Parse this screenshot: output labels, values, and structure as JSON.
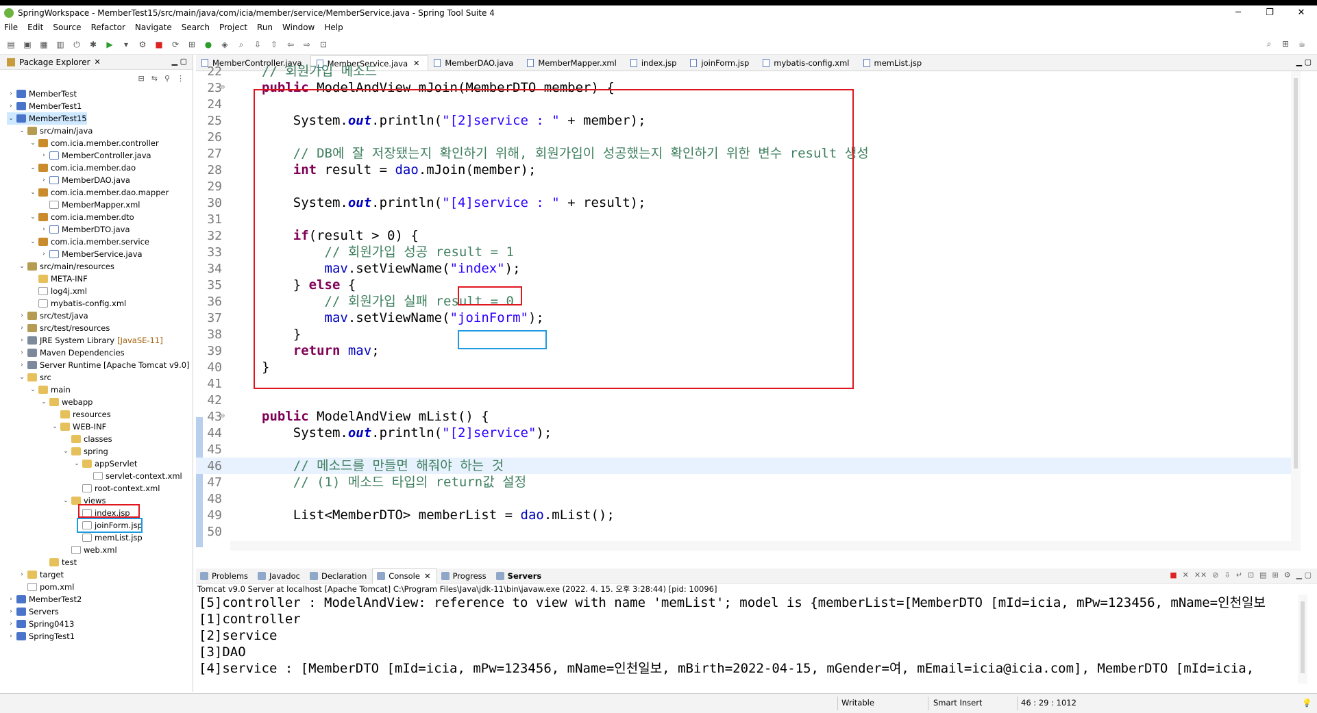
{
  "window": {
    "title": "SpringWorkspace - MemberTest15/src/main/java/com/icia/member/service/MemberService.java - Spring Tool Suite 4",
    "minimize": "─",
    "maximize": "❐",
    "close": "✕"
  },
  "menu": [
    "File",
    "Edit",
    "Source",
    "Refactor",
    "Navigate",
    "Search",
    "Project",
    "Run",
    "Window",
    "Help"
  ],
  "explorer": {
    "title": "Package Explorer",
    "items": [
      {
        "label": "MemberTest",
        "twisty": "›",
        "icon": "project"
      },
      {
        "label": "MemberTest1",
        "twisty": "›",
        "icon": "project"
      },
      {
        "label": "MemberTest15",
        "twisty": "⌄",
        "icon": "project"
      },
      {
        "label": "src/main/java",
        "twisty": "⌄",
        "icon": "srcf"
      },
      {
        "label": "com.icia.member.controller",
        "twisty": "⌄",
        "icon": "pkg"
      },
      {
        "label": "MemberController.java",
        "twisty": "›",
        "icon": "java"
      },
      {
        "label": "com.icia.member.dao",
        "twisty": "⌄",
        "icon": "pkg"
      },
      {
        "label": "MemberDAO.java",
        "twisty": "›",
        "icon": "java"
      },
      {
        "label": "com.icia.member.dao.mapper",
        "twisty": "⌄",
        "icon": "pkg"
      },
      {
        "label": "MemberMapper.xml",
        "twisty": "",
        "icon": "xml"
      },
      {
        "label": "com.icia.member.dto",
        "twisty": "⌄",
        "icon": "pkg"
      },
      {
        "label": "MemberDTO.java",
        "twisty": "›",
        "icon": "java"
      },
      {
        "label": "com.icia.member.service",
        "twisty": "⌄",
        "icon": "pkg"
      },
      {
        "label": "MemberService.java",
        "twisty": "›",
        "icon": "java"
      },
      {
        "label": "src/main/resources",
        "twisty": "⌄",
        "icon": "srcf"
      },
      {
        "label": "META-INF",
        "twisty": "",
        "icon": "folder"
      },
      {
        "label": "log4j.xml",
        "twisty": "",
        "icon": "xml"
      },
      {
        "label": "mybatis-config.xml",
        "twisty": "",
        "icon": "xml"
      },
      {
        "label": "src/test/java",
        "twisty": "›",
        "icon": "srcf"
      },
      {
        "label": "src/test/resources",
        "twisty": "›",
        "icon": "srcf"
      },
      {
        "label": "JRE System Library",
        "twisty": "›",
        "icon": "lib",
        "suffix": "[JavaSE-11]"
      },
      {
        "label": "Maven Dependencies",
        "twisty": "›",
        "icon": "lib"
      },
      {
        "label": "Server Runtime [Apache Tomcat v9.0]",
        "twisty": "›",
        "icon": "lib"
      },
      {
        "label": "src",
        "twisty": "⌄",
        "icon": "folder"
      },
      {
        "label": "main",
        "twisty": "⌄",
        "icon": "folder"
      },
      {
        "label": "webapp",
        "twisty": "⌄",
        "icon": "folder"
      },
      {
        "label": "resources",
        "twisty": "",
        "icon": "folder"
      },
      {
        "label": "WEB-INF",
        "twisty": "⌄",
        "icon": "folder"
      },
      {
        "label": "classes",
        "twisty": "",
        "icon": "folder"
      },
      {
        "label": "spring",
        "twisty": "⌄",
        "icon": "folder"
      },
      {
        "label": "appServlet",
        "twisty": "⌄",
        "icon": "folder"
      },
      {
        "label": "servlet-context.xml",
        "twisty": "",
        "icon": "xml"
      },
      {
        "label": "root-context.xml",
        "twisty": "",
        "icon": "xml"
      },
      {
        "label": "views",
        "twisty": "⌄",
        "icon": "folder"
      },
      {
        "label": "index.jsp",
        "twisty": "",
        "icon": "xml"
      },
      {
        "label": "joinForm.jsp",
        "twisty": "",
        "icon": "xml"
      },
      {
        "label": "memList.jsp",
        "twisty": "",
        "icon": "xml"
      },
      {
        "label": "web.xml",
        "twisty": "",
        "icon": "xml"
      },
      {
        "label": "test",
        "twisty": "",
        "icon": "folder"
      },
      {
        "label": "target",
        "twisty": "›",
        "icon": "folder"
      },
      {
        "label": "pom.xml",
        "twisty": "",
        "icon": "xml"
      },
      {
        "label": "MemberTest2",
        "twisty": "›",
        "icon": "project"
      },
      {
        "label": "Servers",
        "twisty": "›",
        "icon": "project"
      },
      {
        "label": "Spring0413",
        "twisty": "›",
        "icon": "project"
      },
      {
        "label": "SpringTest1",
        "twisty": "›",
        "icon": "project"
      }
    ]
  },
  "editor_tabs": [
    {
      "label": "MemberController.java",
      "active": false
    },
    {
      "label": "MemberService.java",
      "active": true
    },
    {
      "label": "MemberDAO.java",
      "active": false
    },
    {
      "label": "MemberMapper.xml",
      "active": false
    },
    {
      "label": "index.jsp",
      "active": false
    },
    {
      "label": "joinForm.jsp",
      "active": false
    },
    {
      "label": "mybatis-config.xml",
      "active": false
    },
    {
      "label": "memList.jsp",
      "active": false
    }
  ],
  "code_lines": [
    {
      "n": "22",
      "html": "<span class=\"cm\">// 회원가입 메소드</span>"
    },
    {
      "n": "23",
      "html": "<span class=\"kw\">public</span> ModelAndView mJoin(MemberDTO member) {"
    },
    {
      "n": "24",
      "html": ""
    },
    {
      "n": "25",
      "html": "    System.<span class=\"sf\">out</span>.println(<span class=\"st\">\"[2]service : \"</span> + member);"
    },
    {
      "n": "26",
      "html": ""
    },
    {
      "n": "27",
      "html": "    <span class=\"cm\">// DB에 잘 저장됐는지 확인하기 위해, 회원가입이 성공했는지 확인하기 위한 변수 result 생성</span>"
    },
    {
      "n": "28",
      "html": "    <span class=\"kw\">int</span> result = <span class=\"fd\">dao</span>.mJoin(member);"
    },
    {
      "n": "29",
      "html": ""
    },
    {
      "n": "30",
      "html": "    System.<span class=\"sf\">out</span>.println(<span class=\"st\">\"[4]service : \"</span> + result);"
    },
    {
      "n": "31",
      "html": ""
    },
    {
      "n": "32",
      "html": "    <span class=\"kw\">if</span>(result > 0) {"
    },
    {
      "n": "33",
      "html": "        <span class=\"cm\">// 회원가입 성공 result = 1</span>"
    },
    {
      "n": "34",
      "html": "        <span class=\"fd\">mav</span>.setViewName(<span class=\"st\">\"index\"</span>);"
    },
    {
      "n": "35",
      "html": "    } <span class=\"kw\">else</span> {"
    },
    {
      "n": "36",
      "html": "        <span class=\"cm\">// 회원가입 실패 result = 0</span>"
    },
    {
      "n": "37",
      "html": "        <span class=\"fd\">mav</span>.setViewName(<span class=\"st\">\"joinForm\"</span>);"
    },
    {
      "n": "38",
      "html": "    }"
    },
    {
      "n": "39",
      "html": "    <span class=\"kw\">return</span> <span class=\"fd\">mav</span>;"
    },
    {
      "n": "40",
      "html": "}"
    },
    {
      "n": "41",
      "html": ""
    },
    {
      "n": "42",
      "html": ""
    },
    {
      "n": "43",
      "html": "<span class=\"kw\">public</span> ModelAndView mList() {"
    },
    {
      "n": "44",
      "html": "    System.<span class=\"sf\">out</span>.println(<span class=\"st\">\"[2]service\"</span>);"
    },
    {
      "n": "45",
      "html": ""
    },
    {
      "n": "46",
      "html": "    <span class=\"cm\">// 메소드를 만들면 해줘야 하는 것</span>"
    },
    {
      "n": "47",
      "html": "    <span class=\"cm\">// (1) 메소드 타입의 return값 설정</span>"
    },
    {
      "n": "48",
      "html": ""
    },
    {
      "n": "49",
      "html": "    List&lt;MemberDTO&gt; memberList = <span class=\"fd\">dao</span>.mList();"
    },
    {
      "n": "50",
      "html": ""
    }
  ],
  "bottom_tabs": [
    {
      "label": "Problems",
      "active": false
    },
    {
      "label": "Javadoc",
      "active": false
    },
    {
      "label": "Declaration",
      "active": false
    },
    {
      "label": "Console",
      "active": true
    },
    {
      "label": "Progress",
      "active": false
    },
    {
      "label": "Servers",
      "active": false,
      "bold": true
    }
  ],
  "console": {
    "description": "Tomcat v9.0 Server at localhost [Apache Tomcat] C:\\Program Files\\Java\\jdk-11\\bin\\javaw.exe  (2022. 4. 15. 오후 3:28:44) [pid: 10096]",
    "lines": [
      "[5]controller : ModelAndView: reference to view with name 'memList'; model is {memberList=[MemberDTO [mId=icia, mPw=123456, mName=인천일보",
      "[1]controller",
      "[2]service",
      "[3]DAO",
      "[4]service : [MemberDTO [mId=icia, mPw=123456, mName=인천일보, mBirth=2022-04-15, mGender=여, mEmail=icia@icia.com], MemberDTO [mId=icia,"
    ]
  },
  "status": {
    "writable": "Writable",
    "insert_mode": "Smart Insert",
    "position": "46 : 29 : 1012"
  },
  "colors": {
    "highlight_red": "#e0161e",
    "highlight_blue": "#1e9be0",
    "keyword": "#7f0055",
    "comment": "#3f7f5f",
    "string": "#2a00ff"
  }
}
